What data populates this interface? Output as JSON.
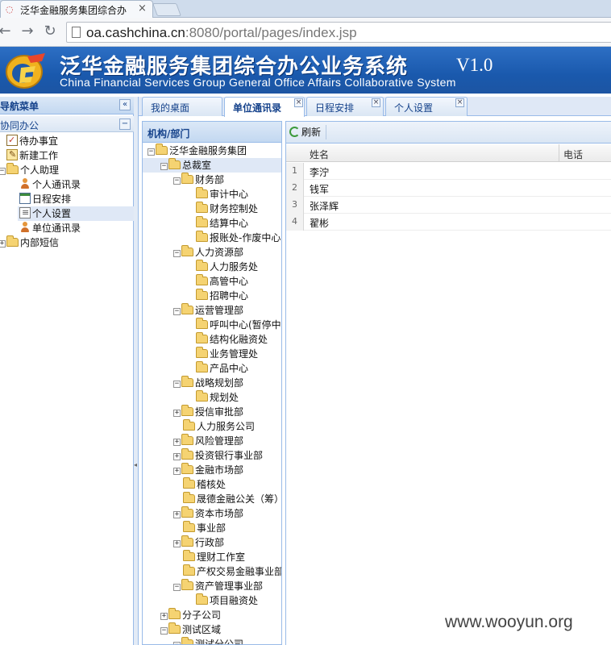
{
  "browser": {
    "tab_title": "泛华金融服务集团综合办",
    "url_host": "oa.cashchina.cn",
    "url_rest": ":8080/portal/pages/index.jsp"
  },
  "header": {
    "title_cn": "泛华金融服务集团综合办公业务系统",
    "version": "V1.0",
    "title_en": "China Financial Services Group General Office Affairs Collaborative System"
  },
  "nav": {
    "title": "导航菜单",
    "section": "协同办公",
    "items": [
      {
        "label": "待办事宜"
      },
      {
        "label": "新建工作"
      },
      {
        "label": "个人助理"
      },
      {
        "label": "个人通讯录"
      },
      {
        "label": "日程安排"
      },
      {
        "label": "个人设置"
      },
      {
        "label": "单位通讯录"
      },
      {
        "label": "内部短信"
      }
    ]
  },
  "tabs": [
    {
      "label": "我的桌面"
    },
    {
      "label": "单位通讯录"
    },
    {
      "label": "日程安排"
    },
    {
      "label": "个人设置"
    }
  ],
  "org": {
    "title": "机构/部门",
    "nodes": [
      {
        "label": "泛华金融服务集团"
      },
      {
        "label": "总裁室"
      },
      {
        "label": "财务部"
      },
      {
        "label": "审计中心"
      },
      {
        "label": "财务控制处"
      },
      {
        "label": "结算中心"
      },
      {
        "label": "报账处-作废中心"
      },
      {
        "label": "人力资源部"
      },
      {
        "label": "人力服务处"
      },
      {
        "label": "高管中心"
      },
      {
        "label": "招聘中心"
      },
      {
        "label": "运营管理部"
      },
      {
        "label": "呼叫中心(暂停中"
      },
      {
        "label": "结构化融资处"
      },
      {
        "label": "业务管理处"
      },
      {
        "label": "产品中心"
      },
      {
        "label": "战略规划部"
      },
      {
        "label": "规划处"
      },
      {
        "label": "授信审批部"
      },
      {
        "label": "人力服务公司"
      },
      {
        "label": "风险管理部"
      },
      {
        "label": "投资银行事业部"
      },
      {
        "label": "金融市场部"
      },
      {
        "label": "稽核处"
      },
      {
        "label": "晟德金融公关（筹）"
      },
      {
        "label": "资本市场部"
      },
      {
        "label": "事业部"
      },
      {
        "label": "行政部"
      },
      {
        "label": "理财工作室"
      },
      {
        "label": "产权交易金融事业部"
      },
      {
        "label": "资产管理事业部"
      },
      {
        "label": "项目融资处"
      },
      {
        "label": "分子公司"
      },
      {
        "label": "测试区域"
      },
      {
        "label": "测试分公司"
      }
    ]
  },
  "grid": {
    "refresh_label": "刷新",
    "col_name": "姓名",
    "col_phone": "电话",
    "rows": [
      {
        "num": "1",
        "name": "李泞"
      },
      {
        "num": "2",
        "name": "钱军"
      },
      {
        "num": "3",
        "name": "张泽辉"
      },
      {
        "num": "4",
        "name": "翟彬"
      }
    ]
  },
  "watermark": "www.wooyun.org"
}
